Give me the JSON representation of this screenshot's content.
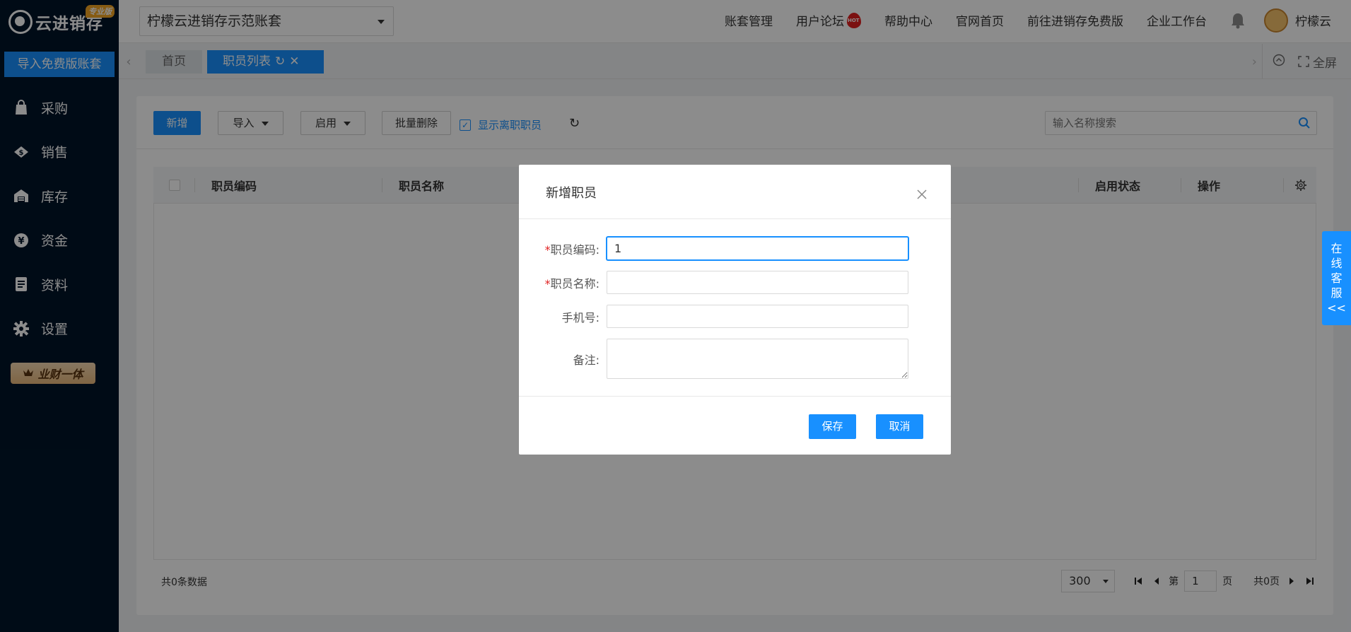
{
  "sidebar": {
    "logo_text": "云进销存",
    "edition_badge": "专业版",
    "import_button": "导入免费版账套",
    "items": [
      {
        "label": "采购",
        "icon": "shopping-bag-icon"
      },
      {
        "label": "销售",
        "icon": "sales-tag-icon"
      },
      {
        "label": "库存",
        "icon": "warehouse-icon"
      },
      {
        "label": "资金",
        "icon": "yen-coin-icon"
      },
      {
        "label": "资料",
        "icon": "document-icon"
      },
      {
        "label": "设置",
        "icon": "gear-icon"
      }
    ],
    "vip_badge": "业财一体"
  },
  "topbar": {
    "account_select": "柠檬云进销存示范账套",
    "links": [
      "账套管理",
      "用户论坛",
      "帮助中心",
      "官网首页",
      "前往进销存免费版",
      "企业工作台"
    ],
    "user_name": "柠檬云"
  },
  "tabs": {
    "home": "首页",
    "active": "职员列表",
    "fullscreen": "全屏"
  },
  "toolbar": {
    "add": "新增",
    "import": "导入",
    "enable": "启用",
    "batch_delete": "批量删除",
    "show_resigned": "显示离职职员",
    "search_placeholder": "输入名称搜索"
  },
  "table": {
    "columns": [
      "职员编码",
      "职员名称",
      "启用状态",
      "操作"
    ]
  },
  "footer": {
    "count_text": "共0条数据",
    "page_size": "300",
    "page_prefix": "第",
    "page_value": "1",
    "page_suffix": "页",
    "total_pages": "共0页"
  },
  "service": {
    "chars": [
      "在",
      "线",
      "客",
      "服",
      "<<"
    ]
  },
  "modal": {
    "title": "新增职员",
    "fields": [
      {
        "label": "职员编码:",
        "required": true,
        "value": "1"
      },
      {
        "label": "职员名称:",
        "required": true,
        "value": ""
      },
      {
        "label": "手机号:",
        "required": false,
        "value": ""
      },
      {
        "label": "备注:",
        "required": false,
        "value": ""
      }
    ],
    "save": "保存",
    "cancel": "取消"
  },
  "colors": {
    "sidebar_bg": "#001529",
    "primary": "#1890ff",
    "required": "#e02020"
  }
}
